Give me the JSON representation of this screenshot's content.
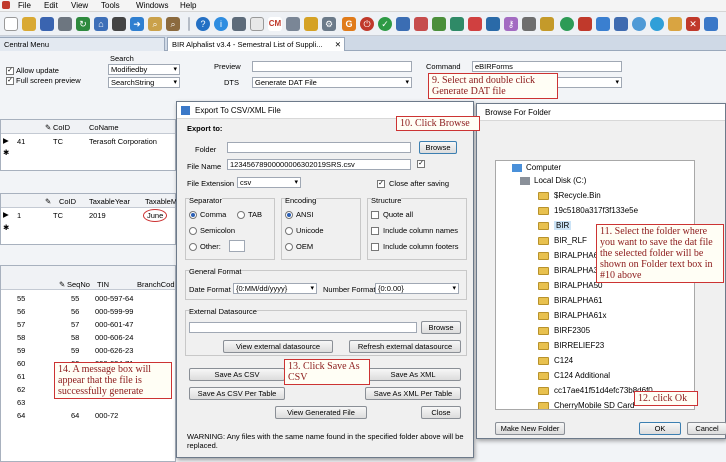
{
  "menu": [
    "File",
    "Edit",
    "View",
    "Tools",
    "Windows",
    "Help"
  ],
  "toolbar_icons": [
    "new-icon",
    "open-icon",
    "save-icon",
    "print-icon",
    "refresh-icon",
    "home-icon",
    "stop-icon",
    "forward-icon",
    "zoom-icon",
    "search-icon",
    "help-icon",
    "info-icon",
    "calc-icon",
    "cm-icon",
    "settings-icon",
    "grid-icon",
    "export-icon",
    "key-icon",
    "lock-icon",
    "check-icon",
    "calendar-icon",
    "chart-icon",
    "exit-icon"
  ],
  "toolbar_cm": "CM",
  "tabs": {
    "left": "Central Menu",
    "main": "BIR Alphalist v3.4 - Semestral List of Suppli..."
  },
  "settings": {
    "allow_update": "Allow update",
    "full_screen": "Full screen preview",
    "search_label": "Search",
    "search_field1": "Modifiedby",
    "search_field2": "SearchString"
  },
  "preview": {
    "preview_label": "Preview",
    "dts_label": "DTS",
    "dts_value": "Generate DAT File",
    "command_label": "Command",
    "command_value": "eBIRForms"
  },
  "grid1": {
    "columns": [
      "CoID",
      "CoName"
    ],
    "rows": [
      [
        "41",
        "TC",
        "Terasoft Corporation"
      ]
    ]
  },
  "grid2": {
    "columns": [
      "CoID",
      "TaxableYear",
      "TaxableM"
    ],
    "rows": [
      [
        "1",
        "TC",
        "2019",
        "June"
      ]
    ]
  },
  "grid3": {
    "columns": [
      "SeqNo",
      "TIN",
      "BranchCod"
    ],
    "rows": [
      [
        "55",
        "55",
        "000-597-64"
      ],
      [
        "56",
        "56",
        "000-599-99"
      ],
      [
        "57",
        "57",
        "000-601-47"
      ],
      [
        "58",
        "58",
        "000-606-24"
      ],
      [
        "59",
        "59",
        "000-626-23"
      ],
      [
        "60",
        "60",
        "000-634-71"
      ],
      [
        "61",
        "",
        ""
      ],
      [
        "62",
        "",
        ""
      ],
      [
        "63",
        "",
        ""
      ],
      [
        "64",
        "64",
        "000-72"
      ]
    ]
  },
  "export_dialog": {
    "title": "Export To CSV/XML File",
    "export_to": "Export to:",
    "folder_label": "Folder",
    "browse": "Browse",
    "filename_label": "File Name",
    "filename_value": "12345678900000006302019SRS.csv",
    "ext_label": "File Extension",
    "ext_value": "csv",
    "close_after": "Close after saving",
    "separator": {
      "title": "Separator",
      "comma": "Comma",
      "tab": "TAB",
      "semicolon": "Semicolon",
      "other": "Other:"
    },
    "encoding": {
      "title": "Encoding",
      "ansi": "ANSI",
      "unicode": "Unicode",
      "oem": "OEM"
    },
    "structure": {
      "title": "Structure",
      "quote_all": "Quote all",
      "include_names": "Include column names",
      "include_footers": "Include column footers"
    },
    "general_format": "General Format",
    "date_label": "Date Format",
    "date_value": "{0:MM/dd/yyyy}",
    "number_label": "Number Format",
    "number_value": "{0:0.00}",
    "ext_ds": "External Datasource",
    "browse2": "Browse",
    "view_ext": "View external datasource",
    "refresh_ext": "Refresh external datasource",
    "save_csv": "Save As CSV",
    "save_xml": "Save As XML",
    "save_csv_table": "Save As CSV Per Table",
    "save_xml_table": "Save As XML Per Table",
    "view_generated": "View Generated File",
    "close": "Close",
    "warning": "WARNING: Any files with the same name found in the specified folder above will be replaced."
  },
  "folder_dialog": {
    "title": "Browse For Folder",
    "computer": "Computer",
    "disk": "Local Disk (C:)",
    "items": [
      "$Recycle.Bin",
      "19c5180a317f3f133e5e",
      "BIR",
      "BIR_RLF",
      "BIRALPHA6",
      "BIRALPHA34",
      "BIRALPHA50",
      "BIRALPHA61",
      "BIRALPHA61x",
      "BIRF2305",
      "BIRRELIEF23",
      "C124",
      "C124 Additional",
      "cc17ae41f51d4efc73b8d6f0",
      "CherryMobile SD Card"
    ],
    "new_folder": "Make New Folder",
    "ok": "OK",
    "cancel": "Cancel"
  },
  "annotations": {
    "n9": "9. Select and double click Generate DAT file",
    "n10": "10. Click Browse",
    "n11a": "11. Select the folder where you want to save the dat file",
    "n11b": "the selected folder will be shown on Folder text box in #10 above",
    "n12": "12. click Ok",
    "n13": "13. Click Save As CSV",
    "n14": "14. A message box will appear that the file is successfully generate"
  },
  "colors": {
    "annotation_border": "#cc3333",
    "annotation_text": "#8b1a1a",
    "folder": "#e8c14f",
    "selection": "#cce4f7"
  }
}
